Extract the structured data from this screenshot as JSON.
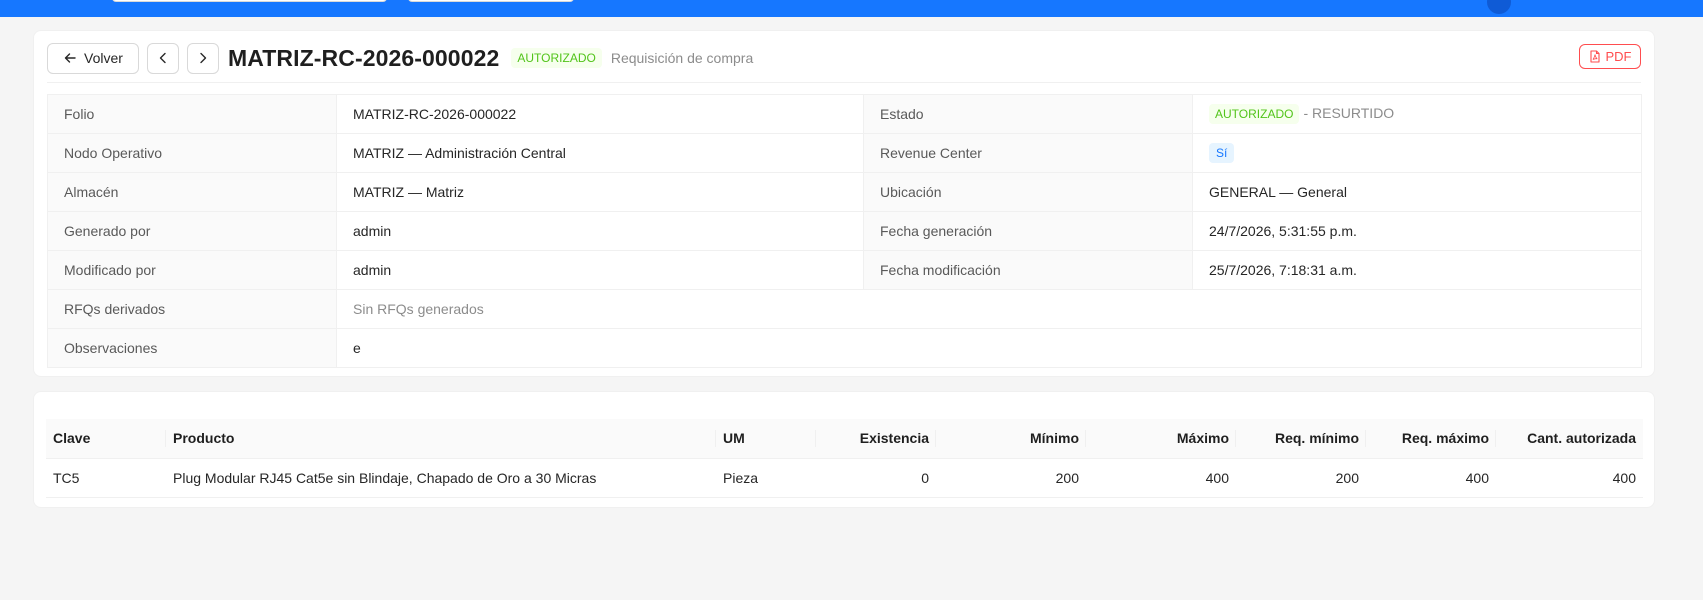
{
  "header": {
    "back_label": "Volver",
    "title": "MATRIZ-RC-2026-000022",
    "status": "AUTORIZADO",
    "subtitle": "Requisición de compra",
    "pdf_label": "PDF"
  },
  "details": {
    "folio": {
      "label": "Folio",
      "value": "MATRIZ-RC-2026-000022"
    },
    "estado": {
      "label": "Estado",
      "tag": "AUTORIZADO",
      "extra": "- RESURTIDO"
    },
    "nodo": {
      "label": "Nodo Operativo",
      "value": "MATRIZ — Administración Central"
    },
    "revenue": {
      "label": "Revenue Center",
      "tag": "Sí"
    },
    "almacen": {
      "label": "Almacén",
      "value": "MATRIZ — Matriz"
    },
    "ubicacion": {
      "label": "Ubicación",
      "value": "GENERAL — General"
    },
    "generado": {
      "label": "Generado por",
      "value": "admin"
    },
    "fecha_gen": {
      "label": "Fecha generación",
      "value": "24/7/2026, 5:31:55 p.m."
    },
    "modificado": {
      "label": "Modificado por",
      "value": "admin"
    },
    "fecha_mod": {
      "label": "Fecha modificación",
      "value": "25/7/2026, 7:18:31 a.m."
    },
    "rfqs": {
      "label": "RFQs derivados",
      "value": "Sin RFQs generados"
    },
    "observaciones": {
      "label": "Observaciones",
      "value": "e"
    }
  },
  "items": {
    "columns": [
      "Clave",
      "Producto",
      "UM",
      "Existencia",
      "Mínimo",
      "Máximo",
      "Req. mínimo",
      "Req. máximo",
      "Cant. autorizada"
    ],
    "rows": [
      [
        "TC5",
        "Plug Modular RJ45 Cat5e sin Blindaje, Chapado de Oro a 30 Micras",
        "Pieza",
        "0",
        "200",
        "400",
        "200",
        "400",
        "400"
      ]
    ]
  },
  "colors": {
    "topbar": "#1677ff",
    "success": "#52c41a",
    "danger": "#ff4d4f",
    "info": "#1677ff"
  }
}
